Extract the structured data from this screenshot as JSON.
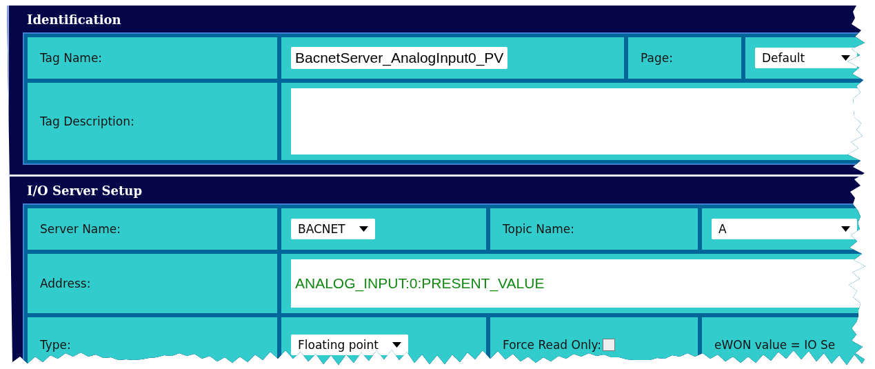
{
  "sections": [
    {
      "title": "Identification",
      "rows": [
        [
          {
            "kind": "label",
            "text": "Tag Name:"
          },
          {
            "kind": "field",
            "value": "BacnetServer_AnalogInput0_PV"
          },
          {
            "kind": "label",
            "text": "Page:"
          },
          {
            "kind": "dropdown",
            "value": "Default"
          }
        ],
        [
          {
            "kind": "label",
            "text": "Tag Description:"
          },
          {
            "kind": "textarea"
          }
        ]
      ]
    },
    {
      "title": "I/O Server Setup",
      "rows": [
        [
          {
            "kind": "label",
            "text": "Server Name:"
          },
          {
            "kind": "dropdown",
            "value": "BACNET"
          },
          {
            "kind": "label",
            "text": "Topic Name:"
          },
          {
            "kind": "dropdown",
            "value": "A"
          }
        ],
        [
          {
            "kind": "label",
            "text": "Address:"
          },
          {
            "kind": "address",
            "value": "ANALOG_INPUT:0:PRESENT_VALUE"
          }
        ],
        [
          {
            "kind": "label",
            "text": "Type:"
          },
          {
            "kind": "dropdown",
            "value": "Floating point"
          },
          {
            "kind": "checkbox",
            "text": "Force Read Only:",
            "checked": false
          },
          {
            "kind": "label",
            "text": "eWON value = IO Se"
          }
        ]
      ]
    }
  ]
}
